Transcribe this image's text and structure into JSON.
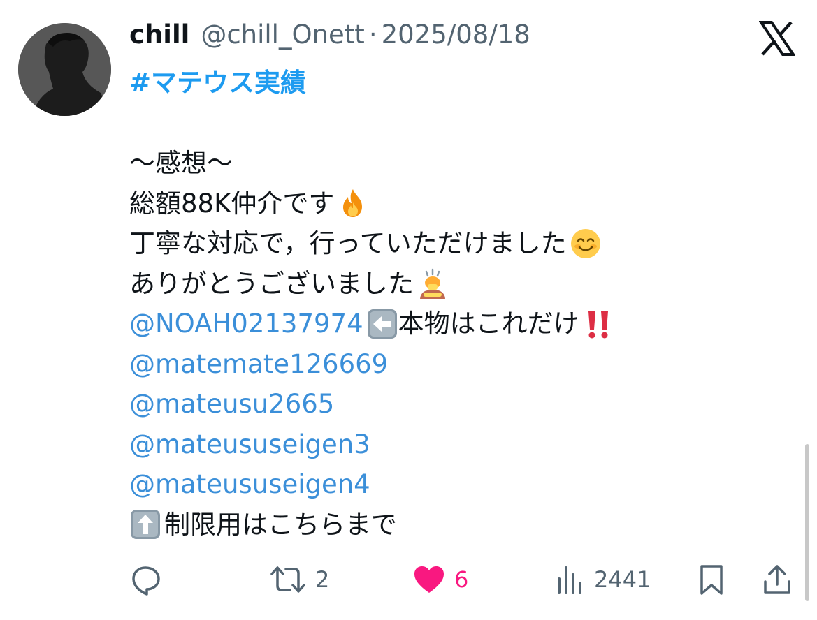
{
  "tweet": {
    "display_name": "chill",
    "handle": "@chill_Onett",
    "separator": "·",
    "date": "2025/08/18",
    "hashtag": "#マテウス実績",
    "lines": {
      "l1": "〜感想〜",
      "l2": "総額88K仲介です",
      "l3": "丁寧な対応で，行っていただけました",
      "l4": "ありがとうございました",
      "l5_mention": "@NOAH02137974",
      "l5_text": "本物はこれだけ",
      "m2": "@matemate126669",
      "m3": "@mateusu2665",
      "m4": "@mateususeigen3",
      "m5": "@mateususeigen4",
      "l10": "制限用はこちらまで"
    },
    "emojis": {
      "fire": "fire-emoji",
      "smile": "smiling-face-emoji",
      "bow": "bowing-person-emoji",
      "left_arrow": "left-arrow-emoji",
      "double_exclamation": "double-exclamation-emoji",
      "up_arrow": "up-arrow-emoji"
    }
  },
  "actions": {
    "reply_icon": "reply-icon",
    "retweet_icon": "retweet-icon",
    "retweet_count": "2",
    "like_icon": "heart-icon",
    "like_count": "6",
    "views_icon": "views-icon",
    "views_count": "2441",
    "bookmark_icon": "bookmark-icon",
    "share_icon": "share-icon"
  },
  "colors": {
    "link": "#3b8fd9",
    "hashtag": "#1d9bf0",
    "like": "#f91880",
    "muted": "#536471",
    "text": "#0f1419"
  }
}
